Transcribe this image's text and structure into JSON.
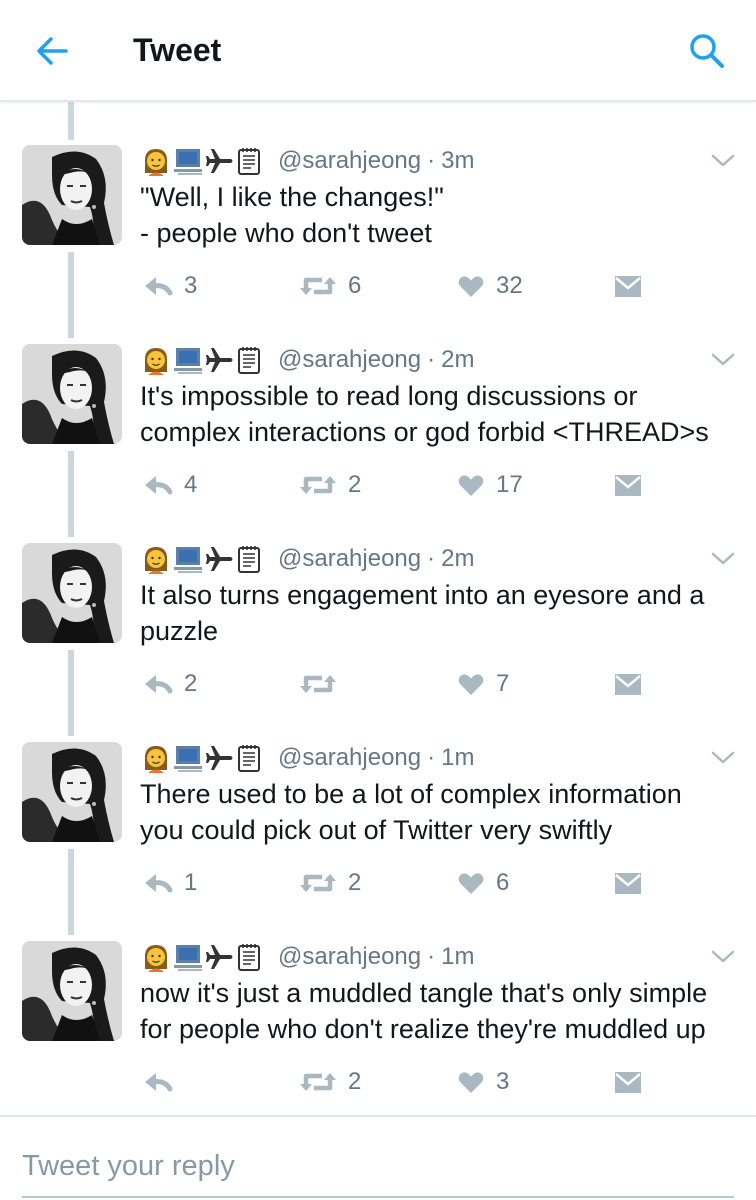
{
  "header": {
    "title": "Tweet",
    "back_icon": "back-arrow-icon",
    "search_icon": "search-icon",
    "accent_color": "#1da1f2"
  },
  "profile": {
    "handle": "@sarahjeong",
    "bio_emoji_icons": [
      "woman-emoji-icon",
      "computer-emoji-icon",
      "airplane-emoji-icon",
      "notepad-emoji-icon"
    ]
  },
  "tweets": [
    {
      "time": "3m",
      "lines": [
        "\"Well, I like the changes!\"",
        "- people who don't tweet"
      ],
      "replies": "3",
      "retweets": "6",
      "likes": "32"
    },
    {
      "time": "2m",
      "lines": [
        "It's impossible to read long discussions or",
        "complex interactions or god forbid <THREAD>s"
      ],
      "replies": "4",
      "retweets": "2",
      "likes": "17"
    },
    {
      "time": "2m",
      "lines": [
        "It also turns engagement into an eyesore and a",
        "puzzle"
      ],
      "replies": "2",
      "retweets": "",
      "likes": "7"
    },
    {
      "time": "1m",
      "lines": [
        "There used to be a lot of complex information",
        "you could pick out of Twitter very swiftly"
      ],
      "replies": "1",
      "retweets": "2",
      "likes": "6"
    },
    {
      "time": "1m",
      "lines": [
        "now it's just a muddled tangle that's only simple",
        "for people who don't realize they're muddled up"
      ],
      "replies": "",
      "retweets": "2",
      "likes": "3"
    }
  ],
  "reply": {
    "placeholder": "Tweet your reply"
  }
}
